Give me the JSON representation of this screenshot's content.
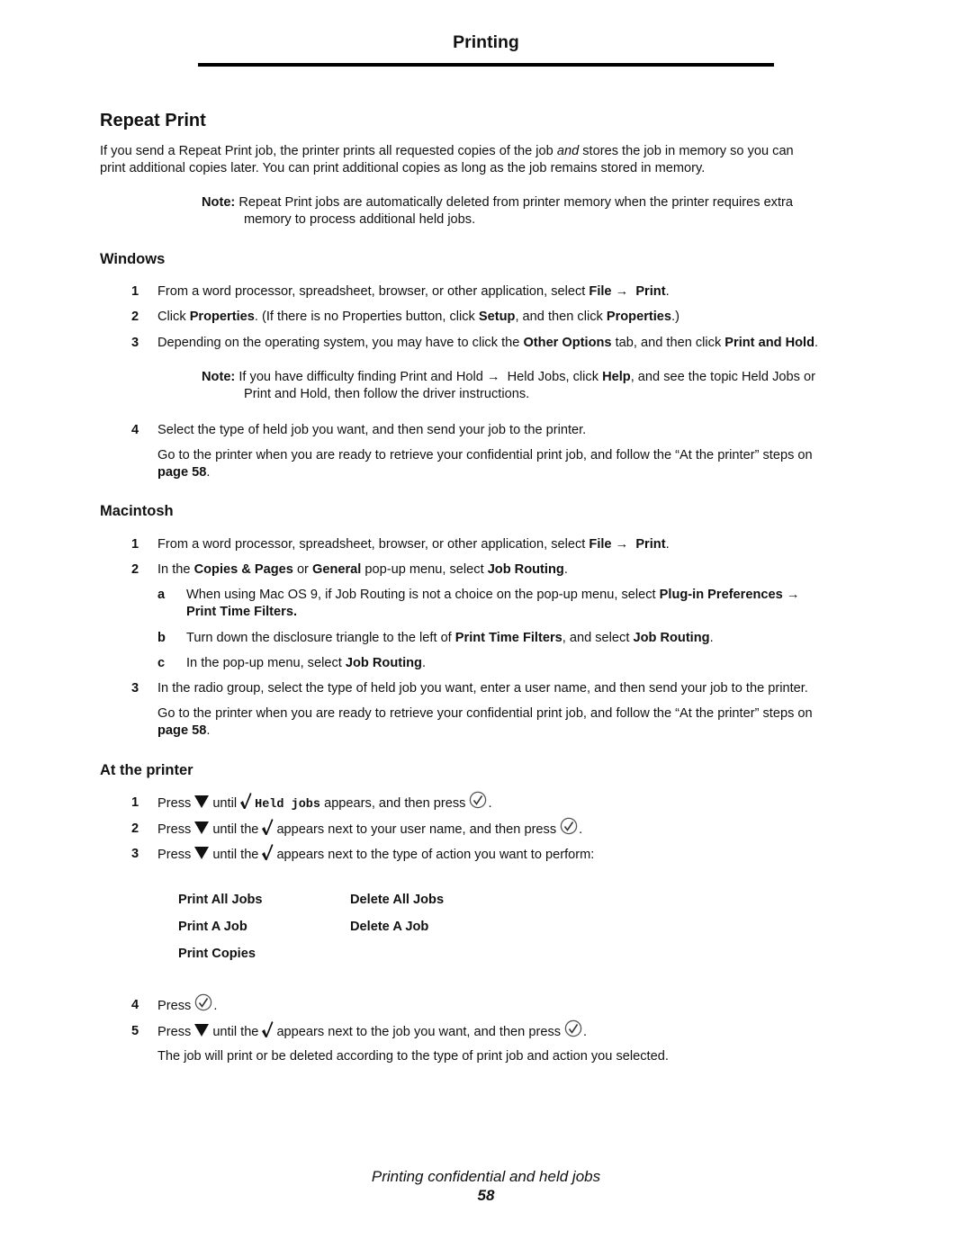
{
  "header": {
    "running_title": "Printing"
  },
  "section": {
    "title": "Repeat Print",
    "intro_1": "If you send a Repeat Print job, the printer prints all requested copies of the job ",
    "intro_em": "and",
    "intro_2": " stores the job in memory so you can",
    "intro_line2": "print additional copies later. You can print additional copies as long as the job remains stored in memory.",
    "note_label": "Note:",
    "note_line1": "Repeat Print jobs are automatically deleted from printer memory when the printer requires extra",
    "note_line2": "memory to process additional held jobs."
  },
  "windows": {
    "title": "Windows",
    "steps": [
      {
        "num": "1",
        "pre": "From a word processor, spreadsheet, browser, or other application, select ",
        "b1": "File",
        "arrow": "→",
        "b2": "Print",
        "post": "."
      },
      {
        "num": "2",
        "t1": "Click ",
        "b1": "Properties",
        "t2": ". (If there is no Properties button, click ",
        "b2": "Setup",
        "t3": ", and then click ",
        "b3": "Properties",
        "t4": ".)"
      },
      {
        "num": "3",
        "t1": "Depending on the operating system, you may have to click the ",
        "b1": "Other Options",
        "t2": " tab, and then click ",
        "b2": "Print and Hold",
        "t3": "."
      },
      {
        "num": "4",
        "text": "Select the type of held job you want, and then send your job to the printer."
      }
    ],
    "note_label": "Note:",
    "note_t1": "If you have difficulty finding Print and Hold ",
    "note_arrow": "→",
    "note_t2": " Held Jobs, click ",
    "note_b1": "Help",
    "note_t3": ", and see the topic Held Jobs or",
    "note_line2": "Print and Hold, then follow the driver instructions.",
    "goto_line1": "Go to the printer when you are ready to retrieve your confidential print job, and follow the “At the printer” steps on",
    "goto_link": "page 58",
    "goto_end": "."
  },
  "macintosh": {
    "title": "Macintosh",
    "step1": {
      "num": "1",
      "pre": "From a word processor, spreadsheet, browser, or other application, select ",
      "b1": "File",
      "arrow": "→",
      "b2": "Print",
      "post": "."
    },
    "step2": {
      "num": "2",
      "t1": "In the ",
      "b1": "Copies & Pages",
      "t2": " or ",
      "b2": "General",
      "t3": " pop-up menu, select ",
      "b3": "Job Routing",
      "t4": "."
    },
    "sub_a": {
      "letter": "a",
      "t1": "When using Mac OS 9, if Job Routing is not a choice on the pop-up menu, select ",
      "b1": "Plug-in Preferences",
      "arrow": "→",
      "line2": "Print Time Filters."
    },
    "sub_b": {
      "letter": "b",
      "t1": "Turn down the disclosure triangle to the left of ",
      "b1": "Print Time Filters",
      "t2": ", and select ",
      "b2": "Job Routing",
      "t3": "."
    },
    "sub_c": {
      "letter": "c",
      "t1": "In the pop-up menu, select ",
      "b1": "Job Routing",
      "t2": "."
    },
    "step3": {
      "num": "3",
      "text": "In the radio group, select the type of held job you want, enter a user name, and then send your job to the printer."
    },
    "goto_line1": "Go to the printer when you are ready to retrieve your confidential print job, and follow the “At the printer” steps on",
    "goto_link": "page 58",
    "goto_end": "."
  },
  "at_printer": {
    "title": "At the printer",
    "step1": {
      "num": "1",
      "press": "Press",
      "until": "until",
      "menu": "Held jobs",
      "t2": "appears, and then press",
      "end": "."
    },
    "step2": {
      "num": "2",
      "press": "Press",
      "until": "until the",
      "t2": "appears next to your user name, and then press",
      "end": "."
    },
    "step3": {
      "num": "3",
      "press": "Press",
      "until": "until the",
      "t2": "appears next to the type of action you want to perform:"
    },
    "options": [
      [
        "Print All Jobs",
        "Delete All Jobs"
      ],
      [
        "Print A Job",
        "Delete A Job"
      ],
      [
        "Print Copies",
        ""
      ]
    ],
    "step4": {
      "num": "4",
      "press": "Press",
      "end": "."
    },
    "step5": {
      "num": "5",
      "press": "Press",
      "until": "until the",
      "t2": "appears next to the job you want, and then press",
      "end": "."
    },
    "closing": "The job will print or be deleted according to the type of print job and action you selected."
  },
  "icons": {
    "down_arrow": "down-arrow-button-icon",
    "checkmark": "checkmark-icon",
    "select_button": "select-button-icon"
  },
  "footer": {
    "chapter": "Printing confidential and held jobs",
    "page": "58"
  }
}
